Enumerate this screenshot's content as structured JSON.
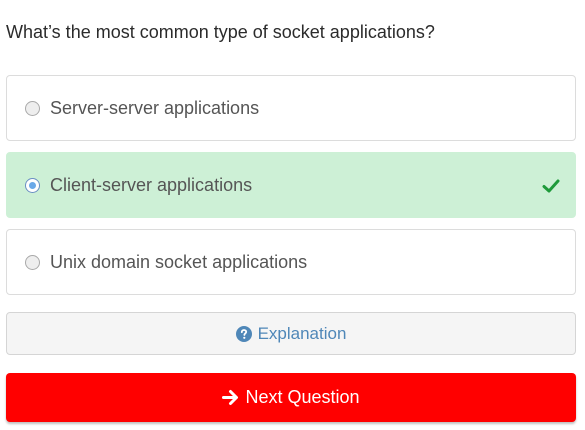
{
  "question": {
    "text": "What’s the most common type of socket applications?"
  },
  "options": [
    {
      "label": "Server-server applications",
      "selected": false,
      "correct": false
    },
    {
      "label": "Client-server applications",
      "selected": true,
      "correct": true
    },
    {
      "label": "Unix domain socket applications",
      "selected": false,
      "correct": false
    }
  ],
  "explanation": {
    "label": "Explanation",
    "icon": "question-circle-icon"
  },
  "next": {
    "label": "Next Question",
    "icon": "arrow-right-icon"
  },
  "colors": {
    "correct_bg": "#cdf0d6",
    "check": "#1e9a3a",
    "next_bg": "#ff0000",
    "link": "#4f87b8"
  }
}
